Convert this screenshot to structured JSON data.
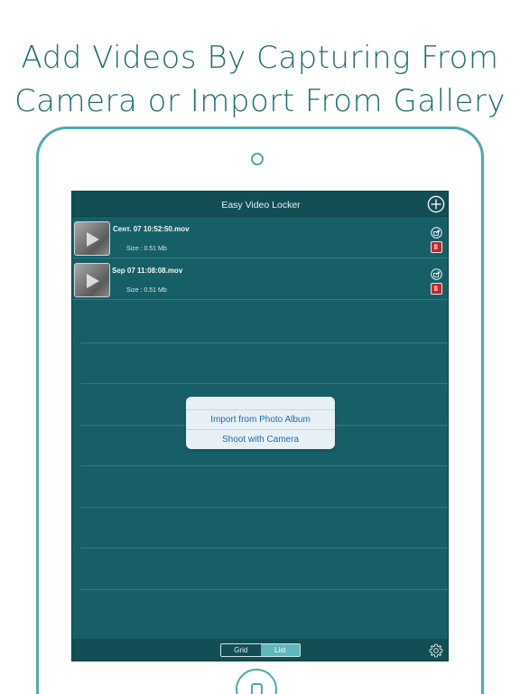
{
  "promo": {
    "headline_line1": "Add Videos By Capturing From",
    "headline_line2": "Camera or Import From Gallery"
  },
  "app": {
    "title": "Easy Video Locker"
  },
  "videos": [
    {
      "name": "Сент. 07 10:52:50.mov",
      "size": "Size : 0.51 Mb"
    },
    {
      "name": "Sep 07 11:08:08.mov",
      "size": "Size : 0.51 Mb"
    }
  ],
  "action_sheet": {
    "import_label": "Import from Photo Album",
    "camera_label": "Shoot with Camera"
  },
  "view_toggle": {
    "grid_label": "Grid",
    "list_label": "List",
    "selected": "List"
  },
  "icons": {
    "add": "plus-circle-icon",
    "share": "share-icon",
    "delete": "trash-icon",
    "settings": "gear-icon",
    "play": "play-icon"
  },
  "colors": {
    "brand_teal": "#1f6f73",
    "frame": "#4fa9ae",
    "screen_bg": "#175f66",
    "bar_bg": "#134e54",
    "delete_red": "#c9242a",
    "action_text": "#1c6bb6",
    "selected_segment": "#5fb6bd"
  }
}
